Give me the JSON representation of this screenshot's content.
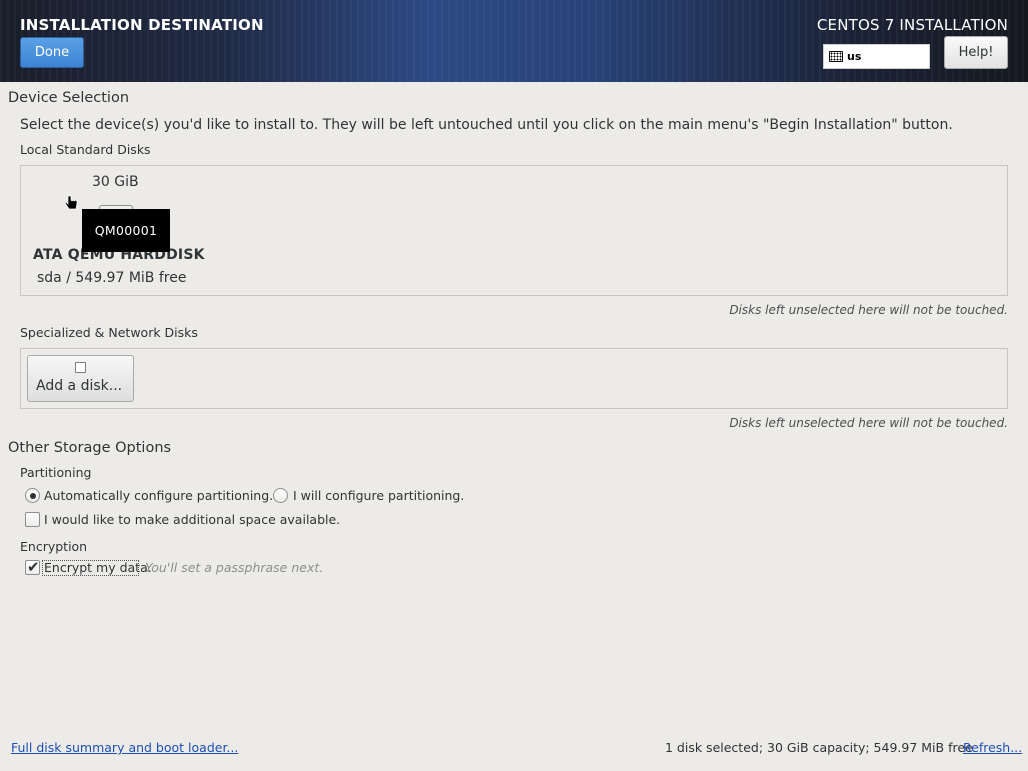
{
  "header": {
    "title": "INSTALLATION DESTINATION",
    "done_label": "Done",
    "product": "CENTOS 7 INSTALLATION",
    "keyboard_layout": "us",
    "help_label": "Help!",
    "kbd_icon": "keyboard-icon"
  },
  "device_selection": {
    "heading": "Device Selection",
    "description": "Select the device(s) you'd like to install to.  They will be left untouched until you click on the main menu's \"Begin Installation\" button.",
    "local_heading": "Local Standard Disks",
    "disk": {
      "size": "30 GiB",
      "name": "ATA QEMU HARDDISK",
      "free": "sda  /  549.97 MiB free",
      "tooltip": "QM00001"
    },
    "local_hint": "Disks left unselected here will not be touched.",
    "specialized_heading": "Specialized & Network Disks",
    "add_disk_label": "Add a disk...",
    "specialized_hint": "Disks left unselected here will not be touched."
  },
  "other_storage": {
    "heading": "Other Storage Options",
    "partitioning_heading": "Partitioning",
    "auto_label": "Automatically configure partitioning.",
    "manual_label": "I will configure partitioning.",
    "space_label": "I would like to make additional space available.",
    "encryption_heading": "Encryption",
    "encrypt_label": "Encrypt my data.",
    "encrypt_hint": "You'll set a passphrase next.",
    "auto_selected": true,
    "encrypt_checked": true,
    "space_checked": false
  },
  "footer": {
    "summary_link": "Full disk summary and boot loader...",
    "status": "1 disk selected; 30 GiB capacity; 549.97 MiB free",
    "refresh_link": "Refresh..."
  },
  "colors": {
    "accent": "#3d83d3",
    "link": "#1c4fb3",
    "background": "#edebe8"
  }
}
